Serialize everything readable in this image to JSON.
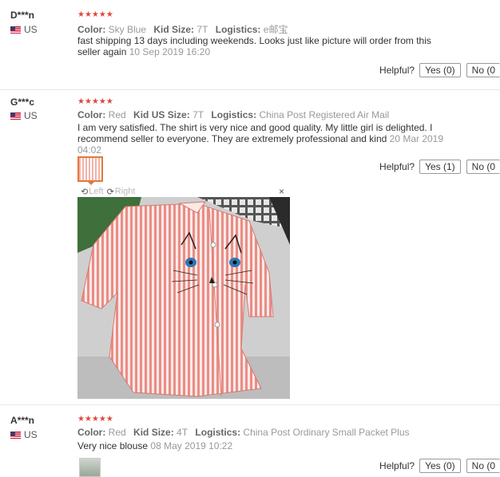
{
  "reviews": [
    {
      "user": "D***n",
      "country": "US",
      "rating": 5,
      "attributes": [
        {
          "key": "Color:",
          "value": "Sky Blue"
        },
        {
          "key": "Kid Size:",
          "value": "7T"
        },
        {
          "key": "Logistics:",
          "value": "e邮宝"
        }
      ],
      "text": "fast shipping 13 days including weekends. Looks just like picture will order from this seller again",
      "date": "10 Sep 2019 16:20",
      "helpful_label": "Helpful?",
      "yes_label": "Yes (0)",
      "no_label": "No (0"
    },
    {
      "user": "G***c",
      "country": "US",
      "rating": 5,
      "attributes": [
        {
          "key": "Color:",
          "value": "Red"
        },
        {
          "key": "Kid US Size:",
          "value": "7T"
        },
        {
          "key": "Logistics:",
          "value": "China Post Registered Air Mail"
        }
      ],
      "text": "I am very satisfied. The shirt is very nice and good quality. My little girl is delighted. I recommend seller to everyone. They are extremely professional and kind",
      "date": "20 Mar 2019 04:02",
      "helpful_label": "Helpful?",
      "yes_label": "Yes (1)",
      "no_label": "No (0"
    },
    {
      "user": "A***n",
      "country": "US",
      "rating": 5,
      "attributes": [
        {
          "key": "Color:",
          "value": "Red"
        },
        {
          "key": "Kid Size:",
          "value": "4T"
        },
        {
          "key": "Logistics:",
          "value": "China Post Ordinary Small Packet Plus"
        }
      ],
      "text": "Very nice blouse",
      "date": "08 May 2019 10:22",
      "helpful_label": "Helpful?",
      "yes_label": "Yes (0)",
      "no_label": "No (0"
    }
  ],
  "viewer": {
    "rotate_left_label": "Left",
    "rotate_right_label": "Right",
    "rotate_left_icon": "rotate-left-icon",
    "rotate_right_icon": "rotate-right-icon",
    "close_icon": "close-icon",
    "close_glyph": "×",
    "rotate_left_glyph": "⟲",
    "rotate_right_glyph": "⟳"
  },
  "colors": {
    "star": "#e1473d",
    "muted": "#999999",
    "active_thumb_border": "#e07a3d"
  }
}
